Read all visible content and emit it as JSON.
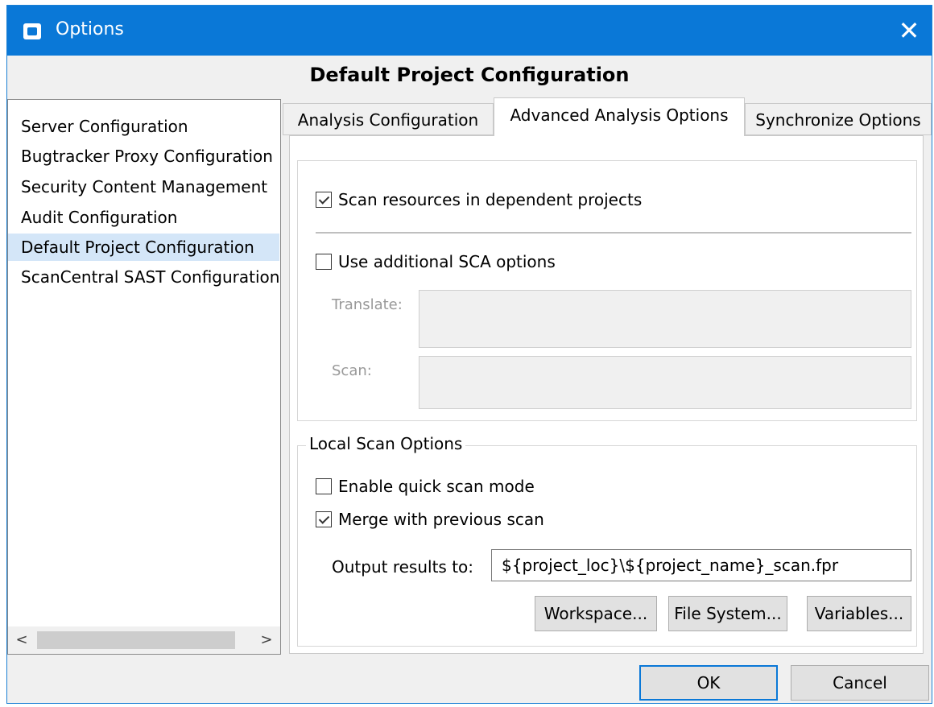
{
  "window": {
    "title": "Options",
    "close_glyph": "✕",
    "icon": "app-icon"
  },
  "page_title": "Default Project Configuration",
  "sidebar": {
    "items": [
      {
        "label": "Server Configuration",
        "selected": false
      },
      {
        "label": "Bugtracker Proxy Configuration",
        "selected": false
      },
      {
        "label": "Security Content Management",
        "selected": false
      },
      {
        "label": "Audit Configuration",
        "selected": false
      },
      {
        "label": "Default Project Configuration",
        "selected": true
      },
      {
        "label": "ScanCentral SAST Configuration",
        "selected": false
      }
    ],
    "scroll_left": "<",
    "scroll_right": ">"
  },
  "tabs": [
    {
      "label": "Analysis Configuration",
      "active": false
    },
    {
      "label": "Advanced Analysis Options",
      "active": true
    },
    {
      "label": "Synchronize Options",
      "active": false
    }
  ],
  "advanced": {
    "scan_dependent": {
      "label": "Scan resources in dependent projects",
      "checked": true
    },
    "use_sca": {
      "label": "Use additional SCA options",
      "checked": false
    },
    "translate_label": "Translate:",
    "scan_label": "Scan:",
    "translate_value": "",
    "scan_value": ""
  },
  "local_scan": {
    "legend": "Local Scan Options",
    "quick_scan": {
      "label": "Enable quick scan mode",
      "checked": false
    },
    "merge": {
      "label": "Merge with previous scan",
      "checked": true
    },
    "output_label": "Output results to:",
    "output_value": "${project_loc}\\${project_name}_scan.fpr",
    "workspace_button": "Workspace...",
    "filesystem_button": "File System...",
    "variables_button": "Variables..."
  },
  "footer": {
    "ok": "OK",
    "cancel": "Cancel"
  },
  "colors": {
    "titlebar": "#0a78d7",
    "selected_item": "#d4e6f8",
    "dialog_bg": "#f0f0f0"
  }
}
